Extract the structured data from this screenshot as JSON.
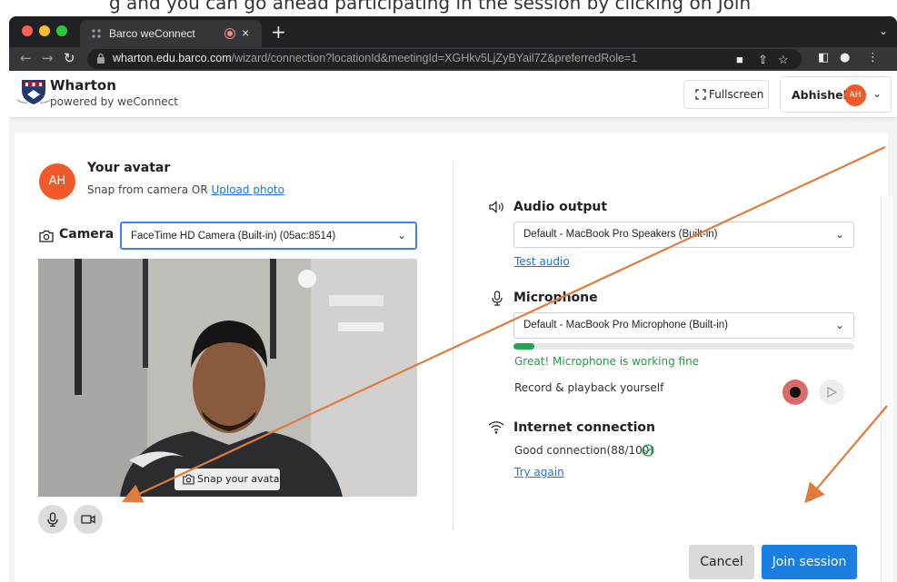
{
  "slide_caption": "g and you can go ahead participating in the session by clicking on Join",
  "browser": {
    "tab_title": "Barco weConnect",
    "tab_close": "×",
    "new_tab": "+",
    "url_host": "wharton.edu.barco.com",
    "url_rest": "/wizard/connection?locationId&meetingId=XGHkv5LjZyBYail7Z&preferredRole=1"
  },
  "header": {
    "org_name": "Wharton",
    "org_subtitle": "powered by weConnect",
    "fullscreen_label": "Fullscreen",
    "user_name": "Abhishek",
    "user_initials": "AH"
  },
  "avatar": {
    "initials": "AH",
    "title": "Your avatar",
    "subtitle_prefix": "Snap from camera OR ",
    "upload_link": "Upload photo"
  },
  "camera": {
    "label": "Camera",
    "selected": "FaceTime HD Camera (Built-in) (05ac:8514)",
    "snap_label": "Snap your avatar"
  },
  "audio_output": {
    "title": "Audio output",
    "selected": "Default - MacBook Pro Speakers (Built-in)",
    "test_link": "Test audio"
  },
  "microphone": {
    "title": "Microphone",
    "selected": "Default - MacBook Pro Microphone (Built-in)",
    "level": 0.06,
    "status": "Great! Microphone is working fine",
    "record_label": "Record & playback yourself"
  },
  "internet": {
    "title": "Internet connection",
    "status": "Good connection(88/100)",
    "retry_link": "Try again"
  },
  "actions": {
    "cancel": "Cancel",
    "join": "Join session"
  },
  "colors": {
    "accent": "#1a7fe0",
    "avatar": "#f05a28",
    "success": "#22a352",
    "record": "#d86a6a",
    "annotation_arrow": "#e07b3c"
  }
}
